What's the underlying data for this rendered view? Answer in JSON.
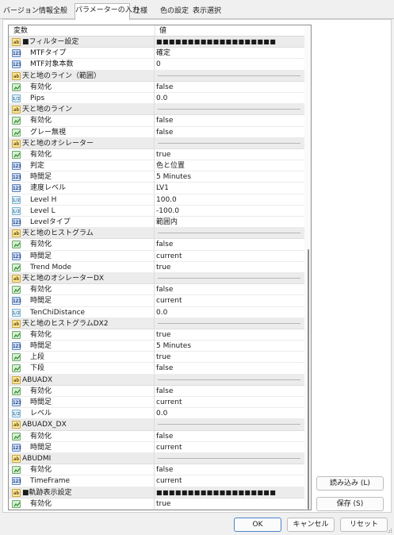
{
  "tabs": [
    {
      "label": "バージョン情報",
      "active": false
    },
    {
      "label": "全般",
      "active": false
    },
    {
      "label": "パラメーターの入力",
      "active": true
    },
    {
      "label": "仕様",
      "active": false
    },
    {
      "label": "色の設定",
      "active": false
    },
    {
      "label": "表示選択",
      "active": false
    }
  ],
  "grid": {
    "col_name": "変数",
    "col_value": "値",
    "rows": [
      {
        "kind": "group",
        "icon": "ab-icon",
        "label": "■フィルター設定",
        "value": "■■■■■■■■■■■■■■■■■■■"
      },
      {
        "kind": "item",
        "icon": "int-icon",
        "label": "MTFタイプ",
        "value": "確定"
      },
      {
        "kind": "item",
        "icon": "int-icon",
        "label": "MTF対象本数",
        "value": "0"
      },
      {
        "kind": "group",
        "icon": "ab-icon",
        "label": "天と地のライン（範囲）",
        "value": "",
        "sep": true
      },
      {
        "kind": "item",
        "icon": "bool-icon",
        "label": "有効化",
        "value": "false"
      },
      {
        "kind": "item",
        "icon": "dbl-icon",
        "label": "Pips",
        "value": "0.0"
      },
      {
        "kind": "group",
        "icon": "ab-icon",
        "label": "天と地のライン",
        "value": "",
        "sep": true
      },
      {
        "kind": "item",
        "icon": "bool-icon",
        "label": "有効化",
        "value": "false"
      },
      {
        "kind": "item",
        "icon": "bool-icon",
        "label": "グレー無視",
        "value": "false"
      },
      {
        "kind": "group",
        "icon": "ab-icon",
        "label": "天と地のオシレーター",
        "value": "",
        "sep": true
      },
      {
        "kind": "item",
        "icon": "bool-icon",
        "label": "有効化",
        "value": "true"
      },
      {
        "kind": "item",
        "icon": "int-icon",
        "label": "判定",
        "value": "色と位置"
      },
      {
        "kind": "item",
        "icon": "int-icon",
        "label": "時間足",
        "value": "5 Minutes"
      },
      {
        "kind": "item",
        "icon": "int-icon",
        "label": "速度レベル",
        "value": "LV1"
      },
      {
        "kind": "item",
        "icon": "dbl-icon",
        "label": "Level H",
        "value": "100.0"
      },
      {
        "kind": "item",
        "icon": "dbl-icon",
        "label": "Level L",
        "value": "-100.0"
      },
      {
        "kind": "item",
        "icon": "int-icon",
        "label": "Levelタイプ",
        "value": "範囲内"
      },
      {
        "kind": "group",
        "icon": "ab-icon",
        "label": "天と地のヒストグラム",
        "value": "",
        "sep": true
      },
      {
        "kind": "item",
        "icon": "bool-icon",
        "label": "有効化",
        "value": "false"
      },
      {
        "kind": "item",
        "icon": "int-icon",
        "label": "時間足",
        "value": "current"
      },
      {
        "kind": "item",
        "icon": "bool-icon",
        "label": "Trend Mode",
        "value": "true"
      },
      {
        "kind": "group",
        "icon": "ab-icon",
        "label": "天と地のオシレーターDX",
        "value": "",
        "sep": true
      },
      {
        "kind": "item",
        "icon": "bool-icon",
        "label": "有効化",
        "value": "false"
      },
      {
        "kind": "item",
        "icon": "int-icon",
        "label": "時間足",
        "value": "current"
      },
      {
        "kind": "item",
        "icon": "dbl-icon",
        "label": "TenChiDistance",
        "value": "0.0"
      },
      {
        "kind": "group",
        "icon": "ab-icon",
        "label": "天と地のヒストグラムDX2",
        "value": "",
        "sep": true
      },
      {
        "kind": "item",
        "icon": "bool-icon",
        "label": "有効化",
        "value": "true"
      },
      {
        "kind": "item",
        "icon": "int-icon",
        "label": "時間足",
        "value": "5 Minutes"
      },
      {
        "kind": "item",
        "icon": "bool-icon",
        "label": "上段",
        "value": "true"
      },
      {
        "kind": "item",
        "icon": "bool-icon",
        "label": "下段",
        "value": "false"
      },
      {
        "kind": "group",
        "icon": "ab-icon",
        "label": "ABUADX",
        "value": "",
        "sep": true
      },
      {
        "kind": "item",
        "icon": "bool-icon",
        "label": "有効化",
        "value": "false"
      },
      {
        "kind": "item",
        "icon": "int-icon",
        "label": "時間足",
        "value": "current"
      },
      {
        "kind": "item",
        "icon": "dbl-icon",
        "label": "レベル",
        "value": "0.0"
      },
      {
        "kind": "group",
        "icon": "ab-icon",
        "label": "ABUADX_DX",
        "value": "",
        "sep": true
      },
      {
        "kind": "item",
        "icon": "bool-icon",
        "label": "有効化",
        "value": "false"
      },
      {
        "kind": "item",
        "icon": "int-icon",
        "label": "時間足",
        "value": "current"
      },
      {
        "kind": "group",
        "icon": "ab-icon",
        "label": "ABUDMI",
        "value": "",
        "sep": true
      },
      {
        "kind": "item",
        "icon": "bool-icon",
        "label": "有効化",
        "value": "false"
      },
      {
        "kind": "item",
        "icon": "int-icon",
        "label": "TimeFrame",
        "value": "current"
      },
      {
        "kind": "group",
        "icon": "ab-icon",
        "label": "■軌跡表示設定",
        "value": "■■■■■■■■■■■■■■■■■■■"
      },
      {
        "kind": "item",
        "icon": "bool-icon",
        "label": "有効化",
        "value": "true"
      }
    ]
  },
  "buttons": {
    "load": "読み込み (L)",
    "save": "保存 (S)",
    "ok": "OK",
    "cancel": "キャンセル",
    "reset": "リセット"
  }
}
